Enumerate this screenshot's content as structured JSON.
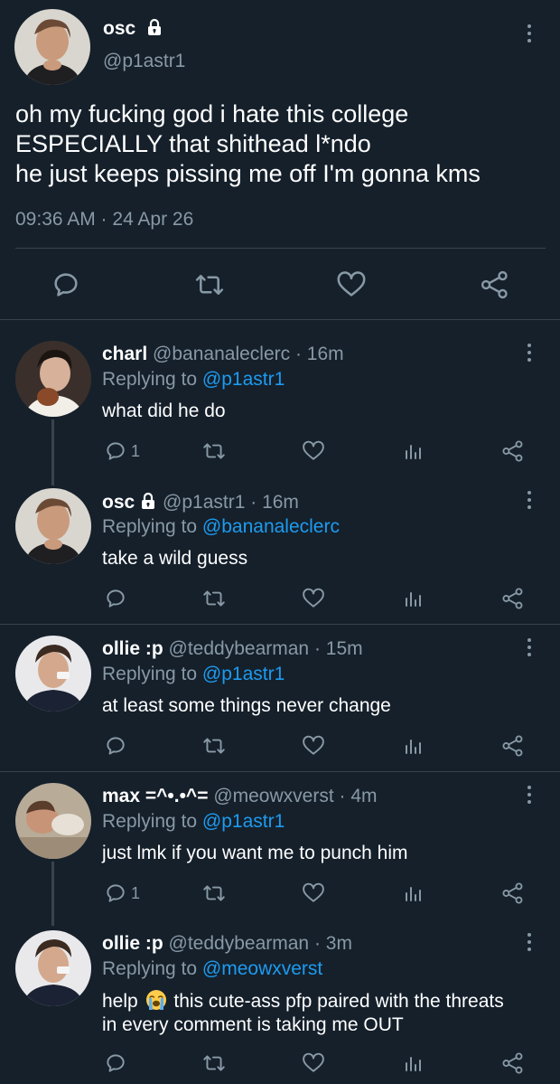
{
  "main_tweet": {
    "display_name": "osc",
    "handle": "@p1astr1",
    "text_lines": [
      "oh my fucking god i hate this college",
      "ESPECIALLY that shithead l*ndo",
      "he just keeps pissing me off I'm gonna kms"
    ],
    "timestamp": "09:36 AM · 24 Apr 26"
  },
  "replies": [
    {
      "display_name": "charl",
      "handle": "@bananaleclerc",
      "time": "· 16m",
      "replying_label": "Replying to",
      "replying_to": "@p1astr1",
      "text": "what did he do",
      "reply_count": "1",
      "locked": false
    },
    {
      "display_name": "osc",
      "handle": "@p1astr1",
      "time": "· 16m",
      "replying_label": "Replying to",
      "replying_to": "@bananaleclerc",
      "text": "take a wild guess",
      "reply_count": "",
      "locked": true
    },
    {
      "display_name": "ollie :p",
      "handle": "@teddybearman",
      "time": "· 15m",
      "replying_label": "Replying to",
      "replying_to": "@p1astr1",
      "text": "at least some things never change",
      "reply_count": "",
      "locked": false
    },
    {
      "display_name": "max =^•.•^=",
      "handle": "@meowxverst",
      "time": "· 4m",
      "replying_label": "Replying to",
      "replying_to": "@p1astr1",
      "text": "just lmk if you want me to punch him",
      "reply_count": "1",
      "locked": false
    },
    {
      "display_name": "ollie :p",
      "handle": "@teddybearman",
      "time": "· 3m",
      "replying_label": "Replying to",
      "replying_to": "@meowxverst",
      "text_before_emoji": "help",
      "text_after_emoji": "this cute-ass pfp paired with the threats",
      "text_line2": "in every comment is taking me OUT",
      "reply_count": "",
      "locked": false
    }
  ],
  "colors": {
    "background": "#15202b",
    "muted": "#8899a6",
    "link": "#1d9bf0",
    "divider": "#38444d"
  },
  "icons": [
    "lock-icon",
    "more-icon",
    "reply-icon",
    "retweet-icon",
    "like-icon",
    "analytics-icon",
    "share-icon",
    "loudly-crying-face-emoji"
  ]
}
